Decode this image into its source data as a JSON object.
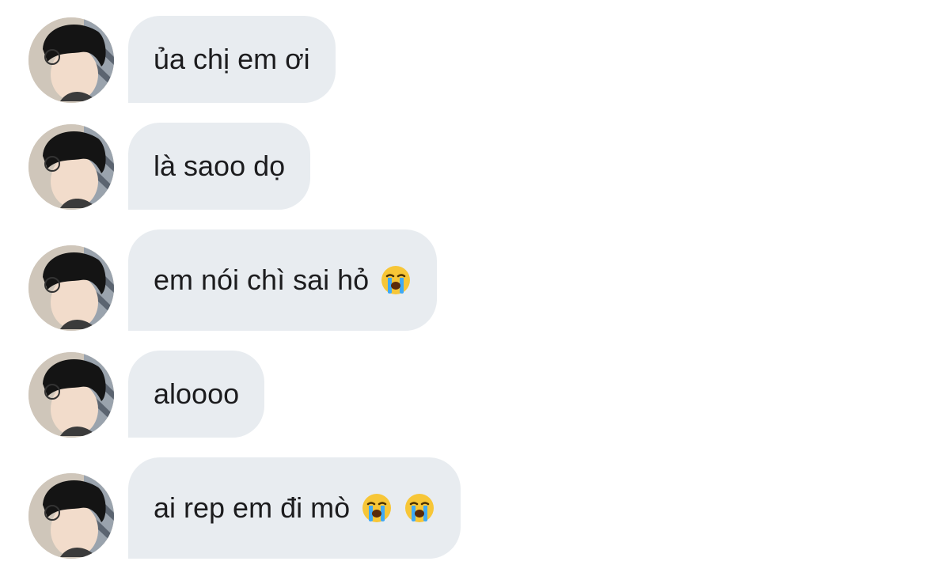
{
  "chat": {
    "messages": [
      {
        "text": "ủa chị em ơi",
        "emojis": []
      },
      {
        "text": "là saoo dọ",
        "emojis": []
      },
      {
        "text": "em nói chì sai hỏ",
        "emojis": [
          "crying-face-emoji"
        ]
      },
      {
        "text": "aloooo",
        "emojis": []
      },
      {
        "text": "ai rep em đi mò",
        "emojis": [
          "crying-face-emoji",
          "crying-face-emoji"
        ]
      }
    ],
    "colors": {
      "bubble": "#e8ecf0",
      "text": "#1c1c1e",
      "background": "#ffffff"
    }
  }
}
